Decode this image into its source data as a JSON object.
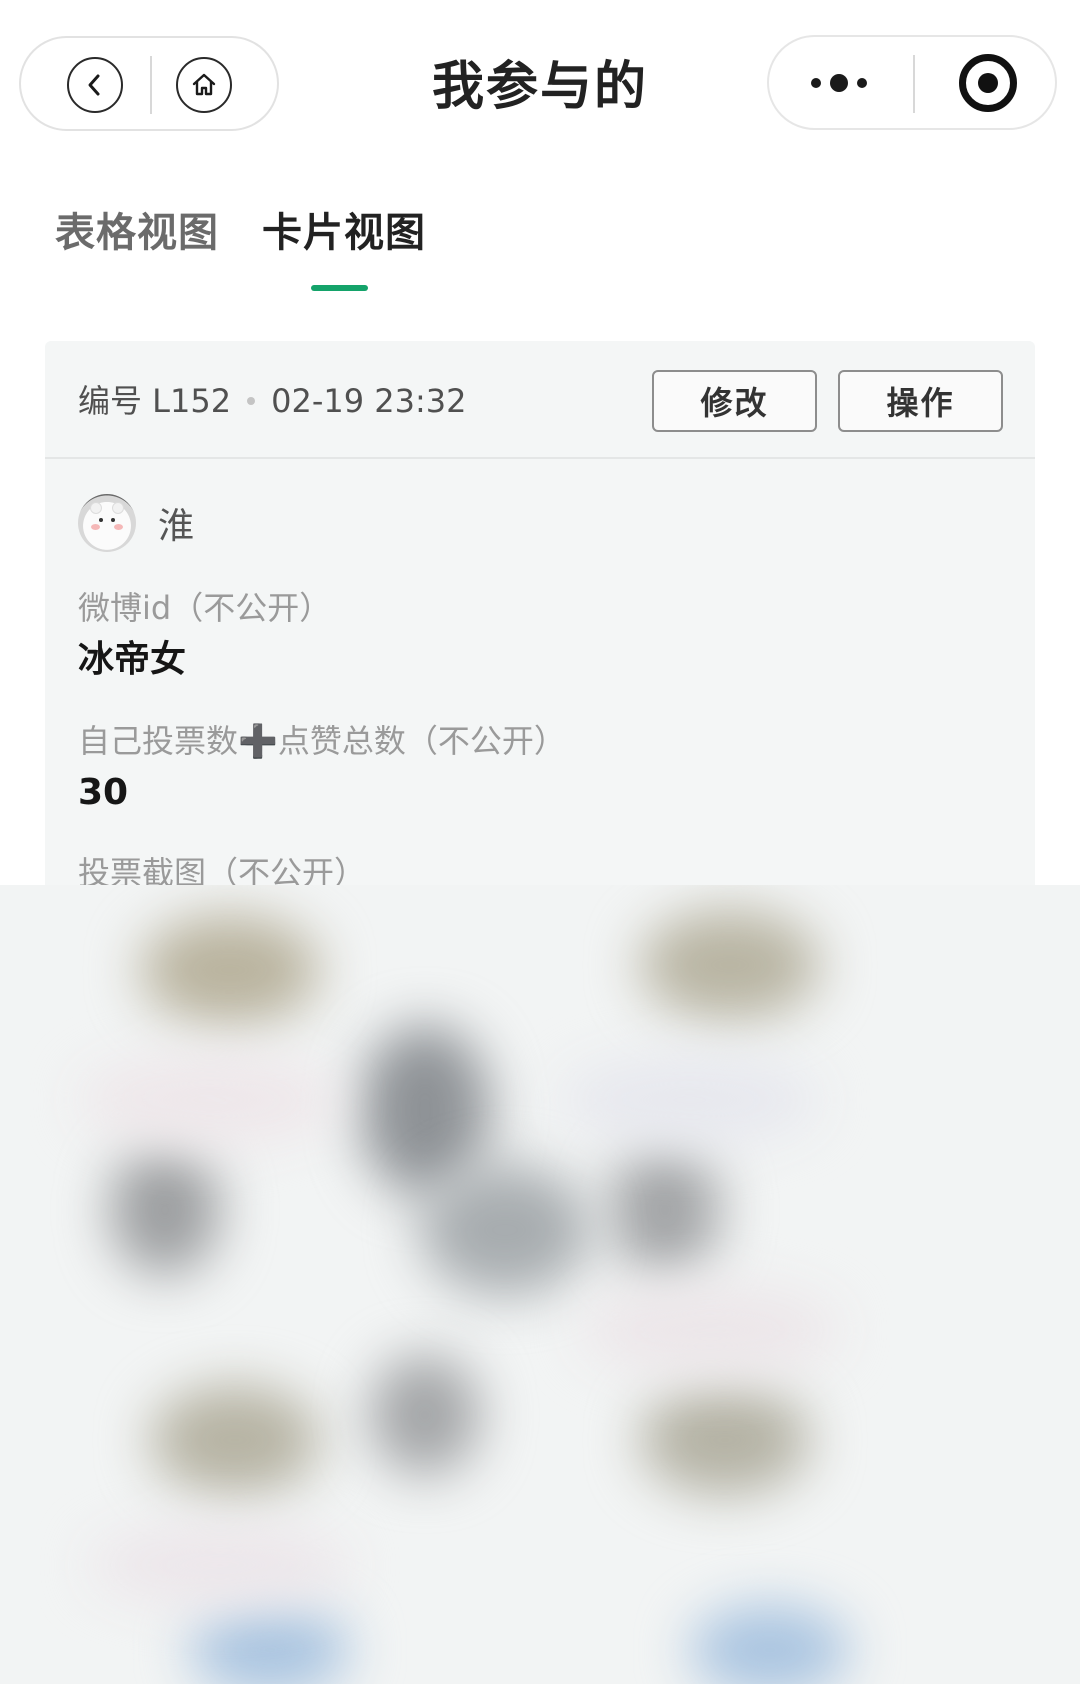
{
  "header": {
    "title": "我参与的",
    "back_icon": "chevron-left-icon",
    "home_icon": "home-icon",
    "more_icon": "more-dots-icon",
    "target_icon": "record-target-icon"
  },
  "tabs": [
    {
      "label": "表格视图",
      "active": false
    },
    {
      "label": "卡片视图",
      "active": true
    }
  ],
  "accent_color": "#14a36a",
  "card": {
    "id_label": "编号 L152",
    "timestamp": "02-19 23:32",
    "edit_button": "修改",
    "action_button": "操作",
    "user": {
      "name": "淮",
      "avatar_icon": "bear-avatar"
    },
    "fields": [
      {
        "label": "微博id（不公开）",
        "value": "冰帝女"
      },
      {
        "label": "自己投票数➕点赞总数（不公开）",
        "value": "30"
      },
      {
        "label": "投票截图（不公开）",
        "value": ""
      }
    ]
  }
}
